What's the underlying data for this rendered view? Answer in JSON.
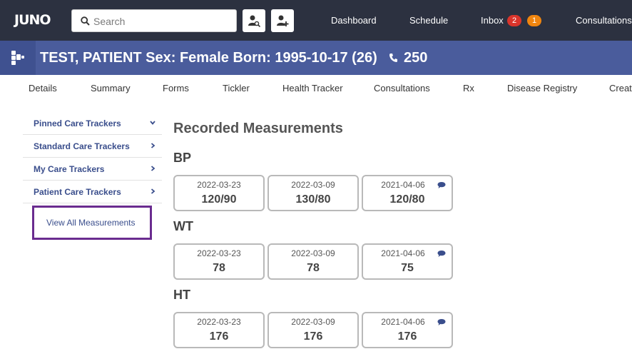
{
  "app": {
    "logo": "JUNO"
  },
  "search": {
    "placeholder": "Search"
  },
  "nav": {
    "dashboard": "Dashboard",
    "schedule": "Schedule",
    "inbox": "Inbox",
    "inbox_badge_red": "2",
    "inbox_badge_orange": "1",
    "consultations": "Consultations"
  },
  "patient": {
    "header": "TEST, PATIENT  Sex: Female Born: 1995-10-17 (26)",
    "phone": "250"
  },
  "tabs": [
    "Details",
    "Summary",
    "Forms",
    "Tickler",
    "Health Tracker",
    "Consultations",
    "Rx",
    "Disease Registry",
    "Create"
  ],
  "sidebar": {
    "items": [
      {
        "label": "Pinned Care Trackers",
        "icon": "chevron-down-icon"
      },
      {
        "label": "Standard Care Trackers",
        "icon": "chevron-right-icon"
      },
      {
        "label": "My Care Trackers",
        "icon": "chevron-right-icon"
      },
      {
        "label": "Patient Care Trackers",
        "icon": "chevron-right-icon"
      }
    ],
    "view_all": "View All Measurements"
  },
  "main": {
    "title": "Recorded Measurements",
    "sections": [
      {
        "label": "BP",
        "cards": [
          {
            "date": "2022-03-23",
            "value": "120/90",
            "note": false
          },
          {
            "date": "2022-03-09",
            "value": "130/80",
            "note": false
          },
          {
            "date": "2021-04-06",
            "value": "120/80",
            "note": true
          }
        ]
      },
      {
        "label": "WT",
        "cards": [
          {
            "date": "2022-03-23",
            "value": "78",
            "note": false
          },
          {
            "date": "2022-03-09",
            "value": "78",
            "note": false
          },
          {
            "date": "2021-04-06",
            "value": "75",
            "note": true
          }
        ]
      },
      {
        "label": "HT",
        "cards": [
          {
            "date": "2022-03-23",
            "value": "176",
            "note": false
          },
          {
            "date": "2022-03-09",
            "value": "176",
            "note": false
          },
          {
            "date": "2021-04-06",
            "value": "176",
            "note": true
          }
        ]
      }
    ]
  },
  "colors": {
    "topbar": "#2c3140",
    "patient_bar": "#4a5c9c",
    "accent_link": "#3a4e8c",
    "highlight_border": "#6a2c8f",
    "badge_red": "#d9342b",
    "badge_orange": "#f0850f"
  }
}
